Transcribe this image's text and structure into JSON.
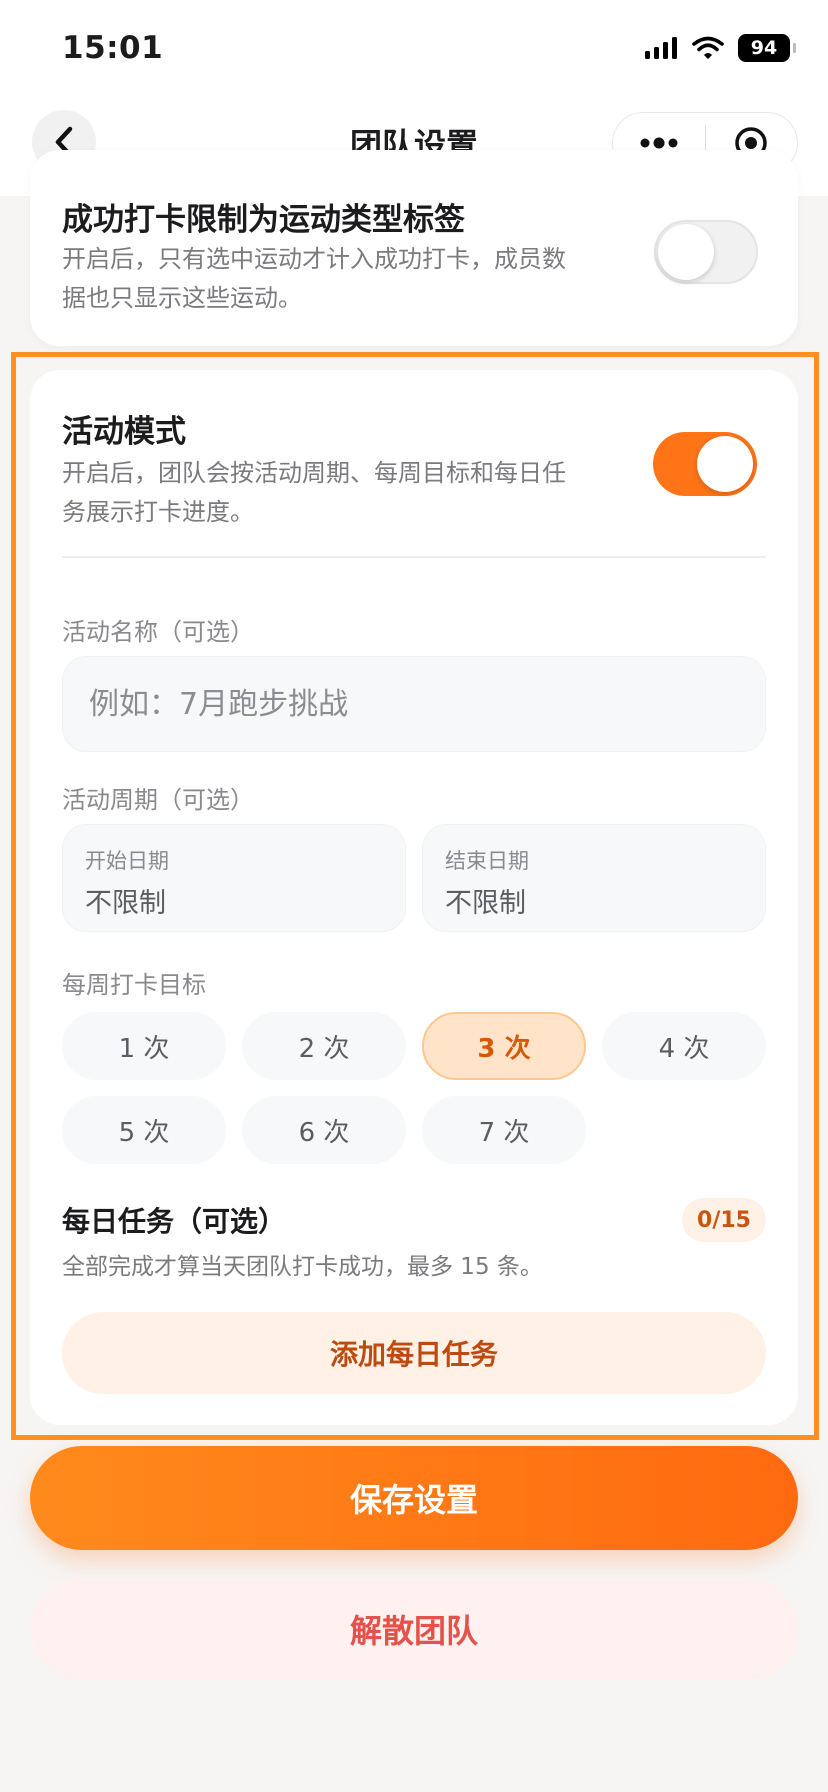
{
  "status_bar": {
    "time": "15:01",
    "battery": "94"
  },
  "nav": {
    "title": "团队设置",
    "icons": [
      "chevron-left-icon",
      "more-dots-icon",
      "record-target-icon"
    ]
  },
  "top_card": {
    "title": "成功打卡限制为运动类型标签",
    "description": "开启后，只有选中运动才计入成功打卡，成员数据也只显示这些运动。",
    "toggle_on": false
  },
  "activity": {
    "title": "活动模式",
    "description": "开启后，团队会按活动周期、每周目标和每日任务展示打卡进度。",
    "toggle_on": true,
    "name_label": "活动名称（可选）",
    "name_value": "",
    "name_placeholder": "例如：7月跑步挑战",
    "period_label": "活动周期（可选）",
    "start": {
      "label": "开始日期",
      "value": "不限制"
    },
    "end": {
      "label": "结束日期",
      "value": "不限制"
    },
    "weekly_label": "每周打卡目标",
    "weekly_options": [
      "1 次",
      "2 次",
      "3 次",
      "4 次",
      "5 次",
      "6 次",
      "7 次"
    ],
    "weekly_selected": "3 次",
    "daily_title": "每日任务（可选）",
    "daily_count": "0/15",
    "daily_desc": "全部完成才算当天团队打卡成功，最多 15 条。",
    "add_task_label": "添加每日任务"
  },
  "actions": {
    "save_label": "保存设置",
    "dissolve_label": "解散团队"
  },
  "colors": {
    "accent": "#ff7417",
    "accent_light": "#ffe4c9",
    "danger": "#e5514b",
    "highlight_frame": "#ff8f1f"
  }
}
